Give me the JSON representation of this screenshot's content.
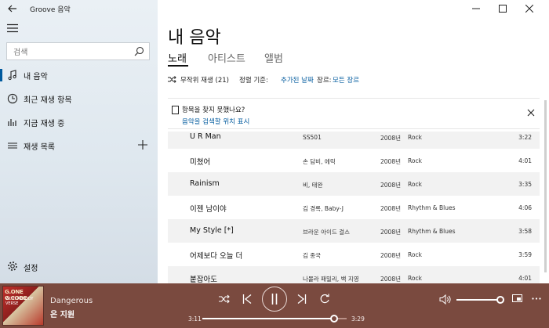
{
  "window": {
    "title": "Groove 음악"
  },
  "sidebar": {
    "search_placeholder": "검색",
    "items": [
      {
        "label": "내 음악",
        "icon": "music-note-icon"
      },
      {
        "label": "최근 재생 항목",
        "icon": "clock-icon"
      },
      {
        "label": "지금 재생 중",
        "icon": "bars-icon"
      },
      {
        "label": "재생 목록",
        "icon": "playlist-icon"
      }
    ],
    "settings_label": "설정"
  },
  "main": {
    "title": "내 음악",
    "tabs": [
      {
        "label": "노래"
      },
      {
        "label": "아티스트"
      },
      {
        "label": "앨범"
      }
    ],
    "toolbar": {
      "shuffle": "무작위 재생 (21)",
      "sort_label": "정렬 기준:",
      "sort_value": "추가된 날짜",
      "genre_label": "장르:",
      "genre_value": "모든 장르"
    },
    "notice": {
      "question": "항목을 찾지 못했나요?",
      "link": "음악을 검색할 위치 표시"
    },
    "songs": [
      {
        "title": "U R Man",
        "artist": "SS501",
        "year": "2008년",
        "genre": "Rock",
        "duration": "3:22"
      },
      {
        "title": "미쳤어",
        "artist": "손 담비, 에릭",
        "year": "2008년",
        "genre": "Rock",
        "duration": "4:01"
      },
      {
        "title": "Rainism",
        "artist": "비, 태완",
        "year": "2008년",
        "genre": "Rock",
        "duration": "3:35"
      },
      {
        "title": "이젠 남이야",
        "artist": "김 경록, Baby-J",
        "year": "2008년",
        "genre": "Rhythm & Blues",
        "duration": "4:06"
      },
      {
        "title": "My Style [*]",
        "artist": "브라운 아이드 걸스",
        "year": "2008년",
        "genre": "Rhythm & Blues",
        "duration": "3:58"
      },
      {
        "title": "어제보다 오늘 더",
        "artist": "김 종국",
        "year": "2008년",
        "genre": "Rock",
        "duration": "3:59"
      },
      {
        "title": "붙잡아도",
        "artist": "나몰라 패밀리, 백 지영",
        "year": "2008년",
        "genre": "Rock",
        "duration": "4:01"
      }
    ]
  },
  "player": {
    "album_art_text": "G.ONE G.CODE",
    "album_art_subtext": "WITH MELODY VERSE",
    "song": "Dangerous",
    "artist": "은 지원",
    "elapsed": "3:11",
    "total": "3:29",
    "progress_fraction": 0.913,
    "volume_fraction": 1.0
  }
}
